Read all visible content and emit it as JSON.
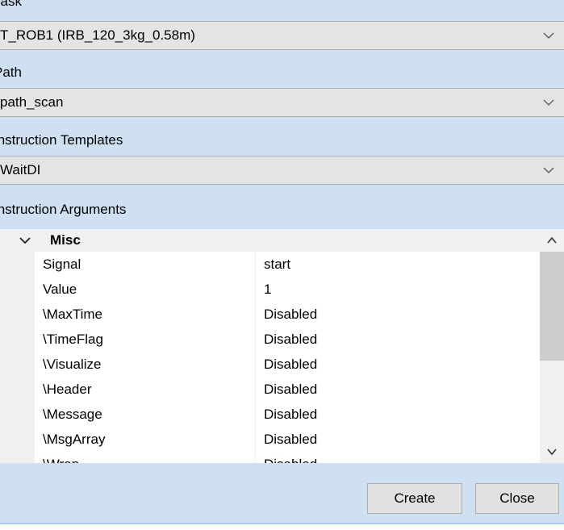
{
  "task": {
    "label": "Task",
    "value": "T_ROB1 (IRB_120_3kg_0.58m)"
  },
  "path": {
    "label": "Path",
    "value": "path_scan"
  },
  "templates": {
    "label": "Instruction Templates",
    "value": "WaitDI"
  },
  "arguments": {
    "label": "Instruction Arguments",
    "category": "Misc",
    "rows": [
      {
        "name": "Signal",
        "value": "start"
      },
      {
        "name": "Value",
        "value": "1"
      },
      {
        "name": "\\MaxTime",
        "value": "Disabled"
      },
      {
        "name": "\\TimeFlag",
        "value": "Disabled"
      },
      {
        "name": "\\Visualize",
        "value": "Disabled"
      },
      {
        "name": "\\Header",
        "value": "Disabled"
      },
      {
        "name": "\\Message",
        "value": "Disabled"
      },
      {
        "name": "\\MsgArray",
        "value": "Disabled"
      },
      {
        "name": "\\Wrap",
        "value": "Disabled"
      }
    ]
  },
  "buttons": {
    "create": "Create",
    "close": "Close"
  }
}
